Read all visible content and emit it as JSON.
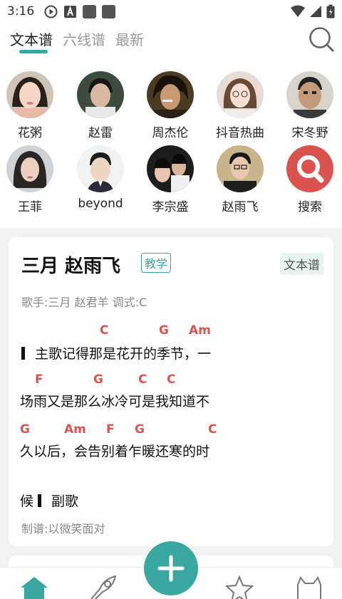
{
  "status_bar": {
    "time": "3:16",
    "icons": [
      "play-circle-icon",
      "a-box-icon",
      "app-icon",
      "app-icon",
      "wifi-icon",
      "signal-icon",
      "battery-icon"
    ]
  },
  "tabs": [
    {
      "label": "文本谱",
      "active": true
    },
    {
      "label": "六线谱",
      "active": false
    },
    {
      "label": "最新",
      "active": false
    }
  ],
  "artists": [
    {
      "name": "花粥"
    },
    {
      "name": "赵雷"
    },
    {
      "name": "周杰伦"
    },
    {
      "name": "抖音热曲"
    },
    {
      "name": "宋冬野"
    },
    {
      "name": "王菲"
    },
    {
      "name": "beyond"
    },
    {
      "name": "李宗盛"
    },
    {
      "name": "赵雨飞"
    },
    {
      "name": "搜索"
    }
  ],
  "card": {
    "title": "三月 赵雨飞",
    "teach_badge": "教学",
    "type_badge": "文本谱",
    "meta": "歌手:三月 赵君羊  调式:C",
    "lines": [
      {
        "chords": [
          "C",
          "G",
          "Am"
        ],
        "text": "主歌记得那是花开的季节，一"
      },
      {
        "chords": [
          "F",
          "G",
          "C",
          "C"
        ],
        "text": "场雨又是那么冰冷可是我知道不"
      },
      {
        "chords": [
          "G",
          "Am",
          "F",
          "G",
          "C"
        ],
        "text": "久以后，会告别着乍暖还寒的时"
      }
    ],
    "section": {
      "prefix": "候",
      "label": "副歌"
    },
    "author": "制谱:以微笑面对"
  },
  "colors": {
    "accent": "#3aa6a0",
    "chord": "#d9534f",
    "search_circle": "#d9534f"
  },
  "nav": [
    "home-icon",
    "rocket-icon",
    "add-icon",
    "star-icon",
    "cat-icon"
  ]
}
